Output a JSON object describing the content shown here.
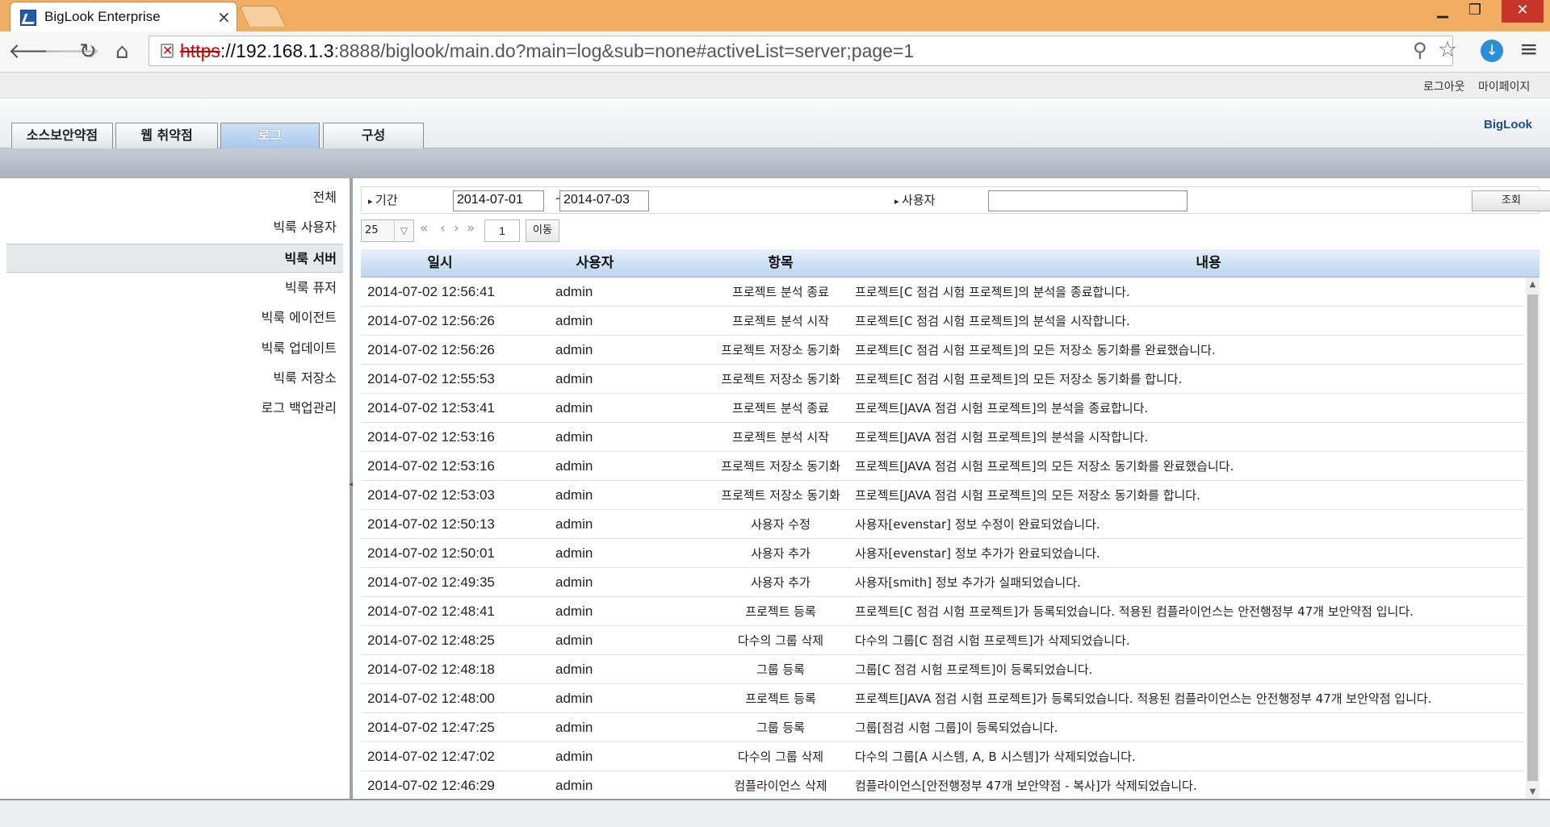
{
  "browser": {
    "tab_title": "BigLook Enterprise",
    "tab_close": "×",
    "url_scheme": "https",
    "url_host": "://192.168.1.3",
    "url_rest": ":8888/biglook/main.do?main=log&sub=none#activeList=server;page=1",
    "minimize": "▁",
    "maximize": "❐",
    "close": "✕"
  },
  "top_links": {
    "logout": "로그아웃",
    "mypage": "마이페이지"
  },
  "brand": "BigLook",
  "main_tabs": [
    {
      "label": "소스보안약점",
      "active": false
    },
    {
      "label": "웹 취약점",
      "active": false
    },
    {
      "label": "로그",
      "active": true
    },
    {
      "label": "구성",
      "active": false
    }
  ],
  "sidebar": {
    "items": [
      {
        "label": "전체",
        "active": false
      },
      {
        "label": "빅룩 사용자",
        "active": false
      },
      {
        "label": "빅룩 서버",
        "active": true
      },
      {
        "label": "빅룩 퓨저",
        "active": false
      },
      {
        "label": "빅룩 에이전트",
        "active": false
      },
      {
        "label": "빅룩 업데이트",
        "active": false
      },
      {
        "label": "빅룩 저장소",
        "active": false
      },
      {
        "label": "로그 백업관리",
        "active": false
      }
    ]
  },
  "filter": {
    "period_label": "기간",
    "date_from": "2014-07-01",
    "tilde": "~",
    "date_to": "2014-07-03",
    "user_label": "사용자",
    "user_value": "",
    "search_button": "조회"
  },
  "pager": {
    "page_size": "25",
    "first": "«",
    "prev": "‹",
    "next": "›",
    "last": "»",
    "page": "1",
    "go_button": "이동"
  },
  "grid": {
    "columns": [
      "일시",
      "사용자",
      "항목",
      "내용"
    ],
    "rows": [
      [
        "2014-07-02 12:56:41",
        "admin",
        "프로젝트 분석 종료",
        "프로젝트[C 점검 시험 프로젝트]의 분석을 종료합니다."
      ],
      [
        "2014-07-02 12:56:26",
        "admin",
        "프로젝트 분석 시작",
        "프로젝트[C 점검 시험 프로젝트]의 분석을 시작합니다."
      ],
      [
        "2014-07-02 12:56:26",
        "admin",
        "프로젝트 저장소 동기화",
        "프로젝트[C 점검 시험 프로젝트]의 모든 저장소 동기화를 완료했습니다."
      ],
      [
        "2014-07-02 12:55:53",
        "admin",
        "프로젝트 저장소 동기화",
        "프로젝트[C 점검 시험 프로젝트]의 모든 저장소 동기화를 합니다."
      ],
      [
        "2014-07-02 12:53:41",
        "admin",
        "프로젝트 분석 종료",
        "프로젝트[JAVA 점검 시험 프로젝트]의 분석을 종료합니다."
      ],
      [
        "2014-07-02 12:53:16",
        "admin",
        "프로젝트 분석 시작",
        "프로젝트[JAVA 점검 시험 프로젝트]의 분석을 시작합니다."
      ],
      [
        "2014-07-02 12:53:16",
        "admin",
        "프로젝트 저장소 동기화",
        "프로젝트[JAVA 점검 시험 프로젝트]의 모든 저장소 동기화를 완료했습니다."
      ],
      [
        "2014-07-02 12:53:03",
        "admin",
        "프로젝트 저장소 동기화",
        "프로젝트[JAVA 점검 시험 프로젝트]의 모든 저장소 동기화를 합니다."
      ],
      [
        "2014-07-02 12:50:13",
        "admin",
        "사용자 수정",
        "사용자[evenstar] 정보 수정이 완료되었습니다."
      ],
      [
        "2014-07-02 12:50:01",
        "admin",
        "사용자 추가",
        "사용자[evenstar] 정보 추가가 완료되었습니다."
      ],
      [
        "2014-07-02 12:49:35",
        "admin",
        "사용자 추가",
        "사용자[smith] 정보 추가가 실패되었습니다."
      ],
      [
        "2014-07-02 12:48:41",
        "admin",
        "프로젝트 등록",
        "프로젝트[C 점검 시험 프로젝트]가 등록되었습니다. 적용된 컴플라이언스는 안전행정부 47개 보안약점 입니다."
      ],
      [
        "2014-07-02 12:48:25",
        "admin",
        "다수의 그룹 삭제",
        "다수의 그룹[C 점검 시험 프로젝트]가 삭제되었습니다."
      ],
      [
        "2014-07-02 12:48:18",
        "admin",
        "그룹 등록",
        "그룹[C 점검 시험 프로젝트]이 등록되었습니다."
      ],
      [
        "2014-07-02 12:48:00",
        "admin",
        "프로젝트 등록",
        "프로젝트[JAVA 점검 시험 프로젝트]가 등록되었습니다. 적용된 컴플라이언스는 안전행정부 47개 보안약점 입니다."
      ],
      [
        "2014-07-02 12:47:25",
        "admin",
        "그룹 등록",
        "그룹[점검 시험 그룹]이 등록되었습니다."
      ],
      [
        "2014-07-02 12:47:02",
        "admin",
        "다수의 그룹 삭제",
        "다수의 그룹[A 시스템, A, B 시스템]가 삭제되었습니다."
      ],
      [
        "2014-07-02 12:46:29",
        "admin",
        "컴플라이언스 삭제",
        "컴플라이언스[안전행정부 47개 보안약점 - 복사]가 삭제되었습니다."
      ]
    ]
  }
}
